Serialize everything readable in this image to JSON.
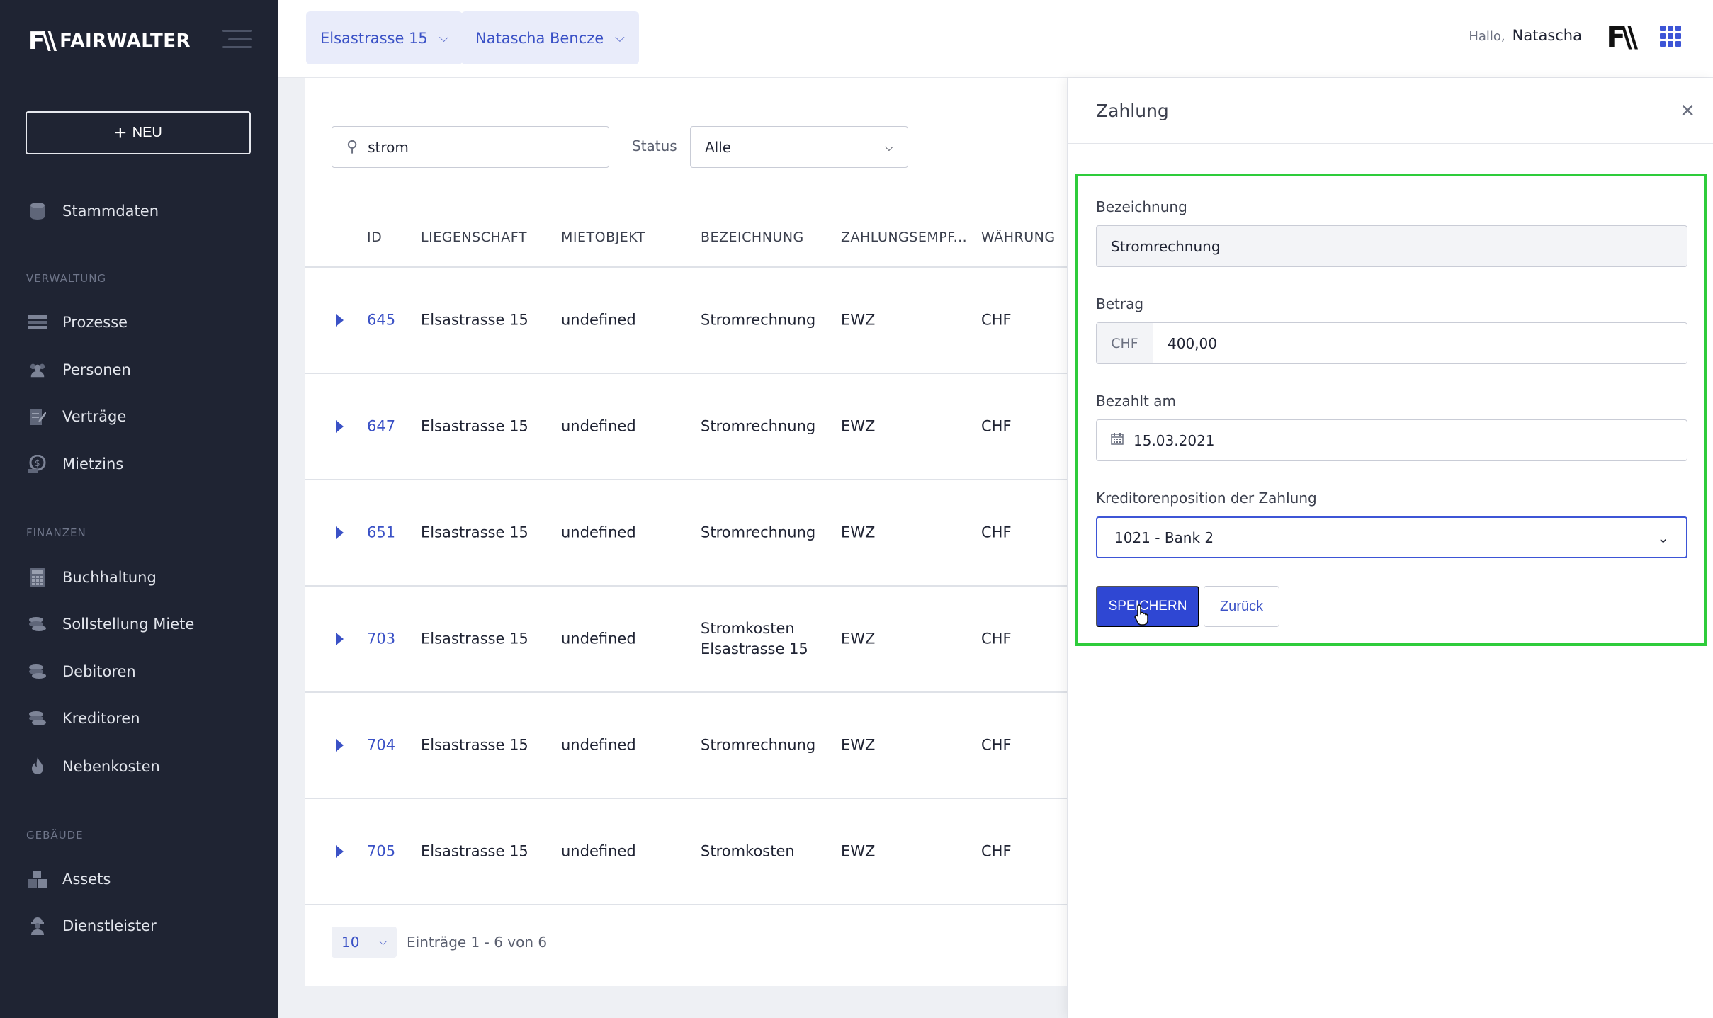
{
  "sidebar": {
    "logo_mark": "F\\\\",
    "logo_text": "FAIRWALTER",
    "new_label": "NEU",
    "sections": {
      "verwaltung": "VERWALTUNG",
      "finanzen": "FINANZEN",
      "gebaeude": "GEBÄUDE"
    },
    "items": {
      "stammdaten": "Stammdaten",
      "prozesse": "Prozesse",
      "personen": "Personen",
      "vertraege": "Verträge",
      "mietzins": "Mietzins",
      "buchhaltung": "Buchhaltung",
      "sollstellung": "Sollstellung Miete",
      "debitoren": "Debitoren",
      "kreditoren": "Kreditoren",
      "nebenkosten": "Nebenkosten",
      "assets": "Assets",
      "dienstleister": "Dienstleister"
    }
  },
  "header": {
    "property_pill": "Elsastrasse 15",
    "person_pill": "Natascha Bencze",
    "hello": "Hallo,",
    "user_name": "Natascha",
    "avatar_mark": "F\\\\"
  },
  "filters": {
    "search_value": "strom",
    "status_label": "Status",
    "status_value": "Alle"
  },
  "table": {
    "headers": {
      "id": "ID",
      "liegenschaft": "LIEGENSCHAFT",
      "mietobjekt": "MIETOBJEKT",
      "bezeichnung": "BEZEICHNUNG",
      "empfaenger": "ZAHLUNGSEMPF...",
      "waehrung": "WÄHRUNG"
    },
    "rows": [
      {
        "id": "645",
        "liegenschaft": "Elsastrasse 15",
        "mietobjekt": "undefined",
        "bezeichnung": "Stromrechnung",
        "empfaenger": "EWZ",
        "waehrung": "CHF"
      },
      {
        "id": "647",
        "liegenschaft": "Elsastrasse 15",
        "mietobjekt": "undefined",
        "bezeichnung": "Stromrechnung",
        "empfaenger": "EWZ",
        "waehrung": "CHF"
      },
      {
        "id": "651",
        "liegenschaft": "Elsastrasse 15",
        "mietobjekt": "undefined",
        "bezeichnung": "Stromrechnung",
        "empfaenger": "EWZ",
        "waehrung": "CHF"
      },
      {
        "id": "703",
        "liegenschaft": "Elsastrasse 15",
        "mietobjekt": "undefined",
        "bezeichnung": "Stromkosten Elsastrasse 15",
        "empfaenger": "EWZ",
        "waehrung": "CHF"
      },
      {
        "id": "704",
        "liegenschaft": "Elsastrasse 15",
        "mietobjekt": "undefined",
        "bezeichnung": "Stromrechnung",
        "empfaenger": "EWZ",
        "waehrung": "CHF"
      },
      {
        "id": "705",
        "liegenschaft": "Elsastrasse 15",
        "mietobjekt": "undefined",
        "bezeichnung": "Stromkosten",
        "empfaenger": "EWZ",
        "waehrung": "CHF"
      }
    ]
  },
  "pagination": {
    "page_size": "10",
    "entries_text": "Einträge 1 - 6 von 6"
  },
  "panel": {
    "title": "Zahlung",
    "bezeichnung_label": "Bezeichnung",
    "bezeichnung_value": "Stromrechnung",
    "betrag_label": "Betrag",
    "betrag_currency": "CHF",
    "betrag_value": "400,00",
    "bezahlt_label": "Bezahlt am",
    "bezahlt_value": "15.03.2021",
    "kreditor_label": "Kreditorenposition der Zahlung",
    "kreditor_value": "1021 - Bank 2",
    "save_label": "SPEICHERN",
    "back_label": "Zurück"
  },
  "colors": {
    "accent": "#2f47d3",
    "sidebar_bg": "#1f2433",
    "highlight": "#2ecc3b"
  }
}
